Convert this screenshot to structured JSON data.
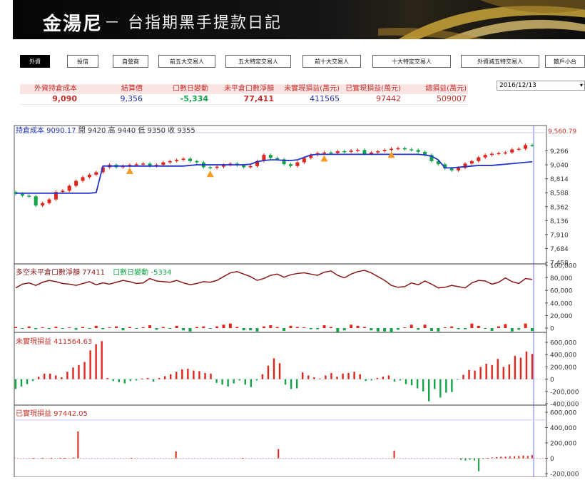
{
  "header": {
    "brand": "金湯尼",
    "subtitle": "－ 台指期黑手提款日記"
  },
  "tabs": [
    {
      "label": "外資",
      "active": true
    },
    {
      "label": "投信",
      "active": false
    },
    {
      "label": "自營商",
      "active": false
    },
    {
      "label": "前五大交易人",
      "active": false
    },
    {
      "label": "五大特定交易人",
      "active": false
    },
    {
      "label": "前十大交易人",
      "active": false
    },
    {
      "label": "十大特定交易人",
      "active": false
    },
    {
      "label": "外資減五特交易人",
      "active": false
    },
    {
      "label": "散戶小台",
      "active": false
    }
  ],
  "stats": [
    {
      "label": "外資持倉成本",
      "value": "9,090",
      "color": "#c4312b",
      "bold": true
    },
    {
      "label": "結算價",
      "value": "9,356",
      "color": "#2233aa",
      "bold": false
    },
    {
      "label": "口數日變動",
      "value": "-5,334",
      "color": "#15a34a",
      "bold": true
    },
    {
      "label": "未平倉口數淨額",
      "value": "77,411",
      "color": "#c4312b",
      "bold": true
    },
    {
      "label": "未實現損益(萬元)",
      "value": "411565",
      "color": "#2233aa",
      "bold": false
    },
    {
      "label": "已實現損益(萬元)",
      "value": "97442",
      "color": "#c4312b",
      "bold": false
    },
    {
      "label": "總損益(萬元)",
      "value": "509007",
      "color": "#c4312b",
      "bold": false
    }
  ],
  "date_select": {
    "value": "2016/12/13"
  },
  "price_panel": {
    "cost_label": "持倉成本 9090.17",
    "ohlc": "開 9420 高 9440 低 9350 收 9355",
    "last_price_label": "9,560.79",
    "ticks": [
      "9,266",
      "9,040",
      "8,814",
      "8,588",
      "8,362",
      "8,136",
      "7,910",
      "7,684",
      "7,458"
    ]
  },
  "oi_panel": {
    "label1": "多空未平倉口數淨額 77411",
    "label2": "口數日變動 -5334",
    "ticks": [
      "100,000",
      "80,000",
      "60,000",
      "40,000",
      "20,000",
      "0"
    ]
  },
  "unrealized_panel": {
    "label": "未實現損益 411564.63",
    "ticks": [
      "600,000",
      "400,000",
      "200,000",
      "0",
      "-200,000",
      "-400,000"
    ]
  },
  "realized_panel": {
    "label": "已實現損益 97442.05",
    "ticks": [
      "600,000",
      "400,000",
      "200,000",
      "0",
      "-200,000"
    ]
  },
  "colors": {
    "up": "#e0261c",
    "down": "#15a34a",
    "cost_line": "#2233cc",
    "oi_line": "#8b1a1a",
    "triangle": "#f59a23",
    "grid": "#c8c8ff"
  },
  "chart_data": [
    {
      "type": "candlestick",
      "title": "持倉成本 9090.17",
      "series": [
        {
          "name": "收",
          "values": [
            8570,
            8540,
            8530,
            8380,
            8420,
            8480,
            8600,
            8620,
            8700,
            8780,
            8840,
            8880,
            8920,
            9000,
            9040,
            9000,
            9020,
            9040,
            9050,
            9060,
            9020,
            9040,
            9080,
            9100,
            9120,
            9140,
            9100,
            9080,
            9000,
            8990,
            9010,
            9040,
            9060,
            9030,
            9000,
            9020,
            9100,
            9200,
            9150,
            9130,
            9050,
            9020,
            9080,
            9150,
            9200,
            9230,
            9240,
            9230,
            9260,
            9250,
            9270,
            9280,
            9220,
            9240,
            9260,
            9280,
            9300,
            9310,
            9290,
            9280,
            9250,
            9200,
            9100,
            9050,
            8980,
            8950,
            8990,
            9060,
            9100,
            9160,
            9200,
            9220,
            9230,
            9240,
            9290,
            9300,
            9360,
            9355
          ]
        },
        {
          "name": "持倉成本",
          "values": [
            8580,
            8580,
            8580,
            8580,
            8580,
            8580,
            8580,
            8580,
            8580,
            8580,
            8580,
            8580,
            8590,
            9020,
            9020,
            9020,
            9020,
            9020,
            9020,
            9020,
            9020,
            9020,
            9020,
            9020,
            9020,
            9020,
            9030,
            9040,
            9040,
            9040,
            9040,
            9040,
            9040,
            9040,
            9040,
            9050,
            9090,
            9110,
            9120,
            9120,
            9110,
            9110,
            9120,
            9160,
            9200,
            9210,
            9210,
            9210,
            9210,
            9210,
            9210,
            9210,
            9210,
            9210,
            9210,
            9210,
            9210,
            9210,
            9210,
            9210,
            9210,
            9200,
            9180,
            9120,
            8990,
            8990,
            9000,
            9010,
            9020,
            9030,
            9030,
            9030,
            9040,
            9050,
            9060,
            9070,
            9080,
            9090
          ]
        }
      ],
      "ylim": [
        7458,
        9560.79
      ]
    },
    {
      "type": "line",
      "title": "多空未平倉口數淨額 77411",
      "series": [
        {
          "name": "多空未平倉口數淨額",
          "values": [
            64000,
            70000,
            72000,
            68000,
            73000,
            76000,
            74000,
            71000,
            70000,
            68000,
            71000,
            74000,
            69000,
            72000,
            70000,
            73000,
            76000,
            74000,
            71000,
            72000,
            79000,
            75000,
            74000,
            73000,
            76000,
            72000,
            69000,
            71000,
            74000,
            73000,
            76000,
            82000,
            88000,
            90000,
            86000,
            82000,
            76000,
            79000,
            84000,
            86000,
            81000,
            85000,
            87000,
            88000,
            86000,
            84000,
            89000,
            91000,
            84000,
            80000,
            86000,
            90000,
            92000,
            88000,
            82000,
            76000,
            68000,
            65000,
            66000,
            72000,
            69000,
            75000,
            70000,
            64000,
            65000,
            68000,
            66000,
            64000,
            72000,
            76000,
            75000,
            70000,
            73000,
            80000,
            74000,
            71000,
            79000,
            77411
          ]
        },
        {
          "name": "口數日變動",
          "values": [
            2000,
            -1000,
            3000,
            -2000,
            1500,
            -1500,
            2500,
            -500,
            1000,
            -3000,
            2000,
            -1000,
            4000,
            -2000,
            1000,
            3000,
            -4000,
            2000,
            -1000,
            1500,
            5000,
            -3000,
            2000,
            -1000,
            4000,
            -4000,
            -6000,
            2000,
            3000,
            -1000,
            3000,
            6000,
            8000,
            2000,
            -4000,
            -4000,
            -6000,
            3000,
            5000,
            2000,
            -5000,
            4000,
            2000,
            1000,
            -2000,
            -2000,
            5000,
            2000,
            -7000,
            -4000,
            6000,
            4000,
            2000,
            -4000,
            -6000,
            -6000,
            -8000,
            -3000,
            1000,
            6000,
            -3000,
            6000,
            -5000,
            -6000,
            1000,
            3000,
            -2000,
            -2000,
            8000,
            4000,
            -1000,
            -5000,
            3000,
            7000,
            -6000,
            -3000,
            8000,
            -5334
          ]
        }
      ],
      "ylim": [
        0,
        100000
      ]
    },
    {
      "type": "bar",
      "title": "未實現損益 411564.63",
      "series": [
        {
          "name": "未實現損益",
          "values": [
            -160000,
            -120000,
            -80000,
            -30000,
            40000,
            90000,
            90000,
            60000,
            30000,
            120000,
            190000,
            230000,
            280000,
            470000,
            570000,
            620000,
            20000,
            -30000,
            -50000,
            -70000,
            -30000,
            -20000,
            10000,
            20000,
            -40000,
            20000,
            50000,
            80000,
            120000,
            160000,
            170000,
            140000,
            130000,
            100000,
            90000,
            -60000,
            -90000,
            -120000,
            -70000,
            -20000,
            -90000,
            -130000,
            -20000,
            80000,
            220000,
            340000,
            260000,
            -90000,
            -160000,
            -150000,
            110000,
            60000,
            30000,
            10000,
            60000,
            100000,
            40000,
            90000,
            100000,
            120000,
            80000,
            -30000,
            -20000,
            20000,
            40000,
            60000,
            -40000,
            -20000,
            -80000,
            -100000,
            -150000,
            -200000,
            -360000,
            -160000,
            -300000,
            -220000,
            -210000,
            -10000,
            70000,
            150000,
            140000,
            200000,
            250000,
            230000,
            330000,
            200000,
            240000,
            380000,
            350000,
            450000,
            411565
          ]
        }
      ],
      "ylim": [
        -400000,
        600000
      ]
    },
    {
      "type": "bar",
      "title": "已實現損益 97442.05",
      "series": [
        {
          "name": "已實現損益",
          "values": [
            0,
            0,
            0,
            0,
            2000,
            0,
            3000,
            0,
            2000,
            0,
            4000,
            5000,
            0,
            8000,
            350000,
            0,
            0,
            0,
            0,
            0,
            0,
            0,
            0,
            0,
            0,
            0,
            5000,
            0,
            0,
            0,
            0,
            0,
            0,
            0,
            0,
            0,
            90000,
            0,
            0,
            0,
            0,
            0,
            0,
            0,
            0,
            0,
            0,
            0,
            0,
            0,
            0,
            5000,
            0,
            0,
            0,
            0,
            0,
            0,
            0,
            120000,
            0,
            0,
            0,
            0,
            0,
            0,
            0,
            0,
            0,
            0,
            0,
            0,
            0,
            0,
            0,
            0,
            0,
            0,
            0,
            0,
            0,
            0,
            0,
            0,
            0,
            100000,
            0,
            0,
            0,
            0,
            0,
            0,
            0,
            0,
            0,
            0,
            0,
            0,
            0,
            0,
            -20000,
            -30000,
            -20000,
            -30000,
            -170000,
            -10000,
            5000,
            10000,
            15000,
            20000,
            20000,
            25000,
            25000,
            30000,
            35000,
            30000,
            40000
          ]
        }
      ],
      "ylim": [
        -200000,
        600000
      ]
    }
  ]
}
